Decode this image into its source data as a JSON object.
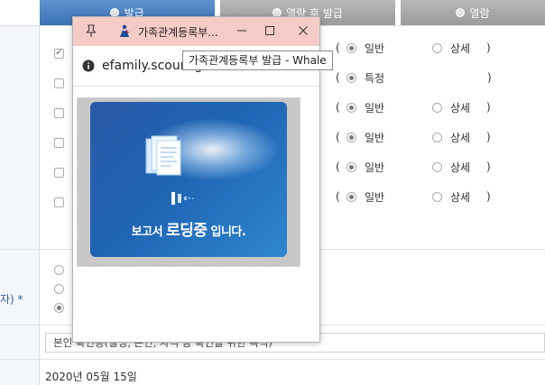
{
  "tabs": [
    {
      "label": "발급"
    },
    {
      "label": "열람 후 발급"
    },
    {
      "label": "열람"
    }
  ],
  "options": {
    "normal": "일반",
    "detail": "상세",
    "special": "특정",
    "open_paren": "(",
    "close_paren": ")"
  },
  "left_label": "자) *",
  "purpose_text": "본인 확인용(실명, 본인, 자격 등 확인을 위한 목적)",
  "date_text": "2020년 05월 15일",
  "popup": {
    "title": "가족관계등록부...",
    "url": "efamily.scourt.go.kr",
    "tooltip": "가족관계등록부 발급 - Whale",
    "loading_prefix": "보고서 ",
    "loading_emphasis": "로딩중",
    "loading_suffix": " 입니다."
  },
  "colors": {
    "active_tab": "#3b72b5",
    "inactive_tab": "#a8a8a8",
    "titlebar": "#f4cbc6",
    "loading_card": "#1f63b3"
  }
}
